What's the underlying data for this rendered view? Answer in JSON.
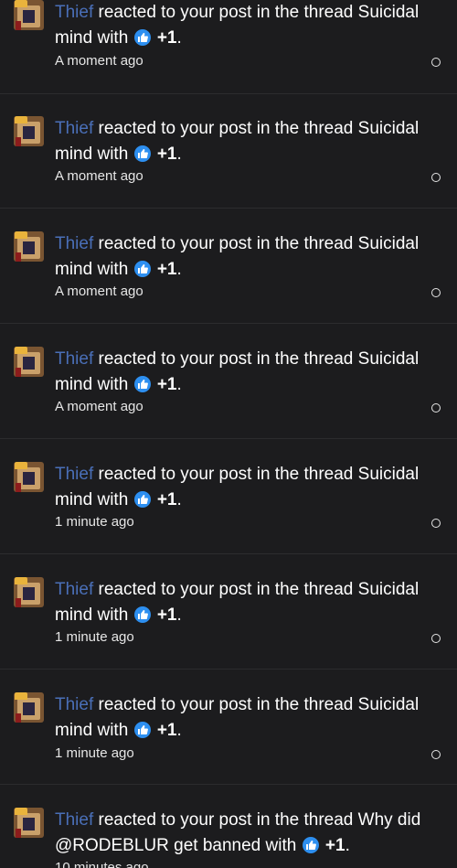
{
  "notifications": [
    {
      "user": "Thief",
      "action": " reacted to your post in the thread ",
      "thread": "Suicidal mind",
      "with": " with ",
      "reaction": "+1",
      "end": ".",
      "time": "A moment ago"
    },
    {
      "user": "Thief",
      "action": " reacted to your post in the thread ",
      "thread": "Suicidal mind",
      "with": " with ",
      "reaction": "+1",
      "end": ".",
      "time": "A moment ago"
    },
    {
      "user": "Thief",
      "action": " reacted to your post in the thread ",
      "thread": "Suicidal mind",
      "with": " with ",
      "reaction": "+1",
      "end": ".",
      "time": "A moment ago"
    },
    {
      "user": "Thief",
      "action": " reacted to your post in the thread ",
      "thread": "Suicidal mind",
      "with": " with ",
      "reaction": "+1",
      "end": ".",
      "time": "A moment ago"
    },
    {
      "user": "Thief",
      "action": " reacted to your post in the thread ",
      "thread": "Suicidal mind",
      "with": " with ",
      "reaction": "+1",
      "end": ".",
      "time": "1 minute ago"
    },
    {
      "user": "Thief",
      "action": " reacted to your post in the thread ",
      "thread": "Suicidal mind",
      "with": " with ",
      "reaction": "+1",
      "end": ".",
      "time": "1 minute ago"
    },
    {
      "user": "Thief",
      "action": " reacted to your post in the thread ",
      "thread": "Suicidal mind",
      "with": " with ",
      "reaction": "+1",
      "end": ".",
      "time": "1 minute ago"
    },
    {
      "user": "Thief",
      "action": " reacted to your post in the thread ",
      "thread": "Why did @RODEBLUR get banned",
      "with": " with ",
      "reaction": "+1",
      "end": ".",
      "time": "10 minutes ago"
    }
  ],
  "icons": {
    "avatar": "user-avatar",
    "reaction": "like-icon",
    "mark_read": "circle-icon"
  },
  "colors": {
    "background": "#1c1c1e",
    "username": "#4a6fb8",
    "like": "#2d8ff0",
    "divider": "#2c2c2e"
  }
}
